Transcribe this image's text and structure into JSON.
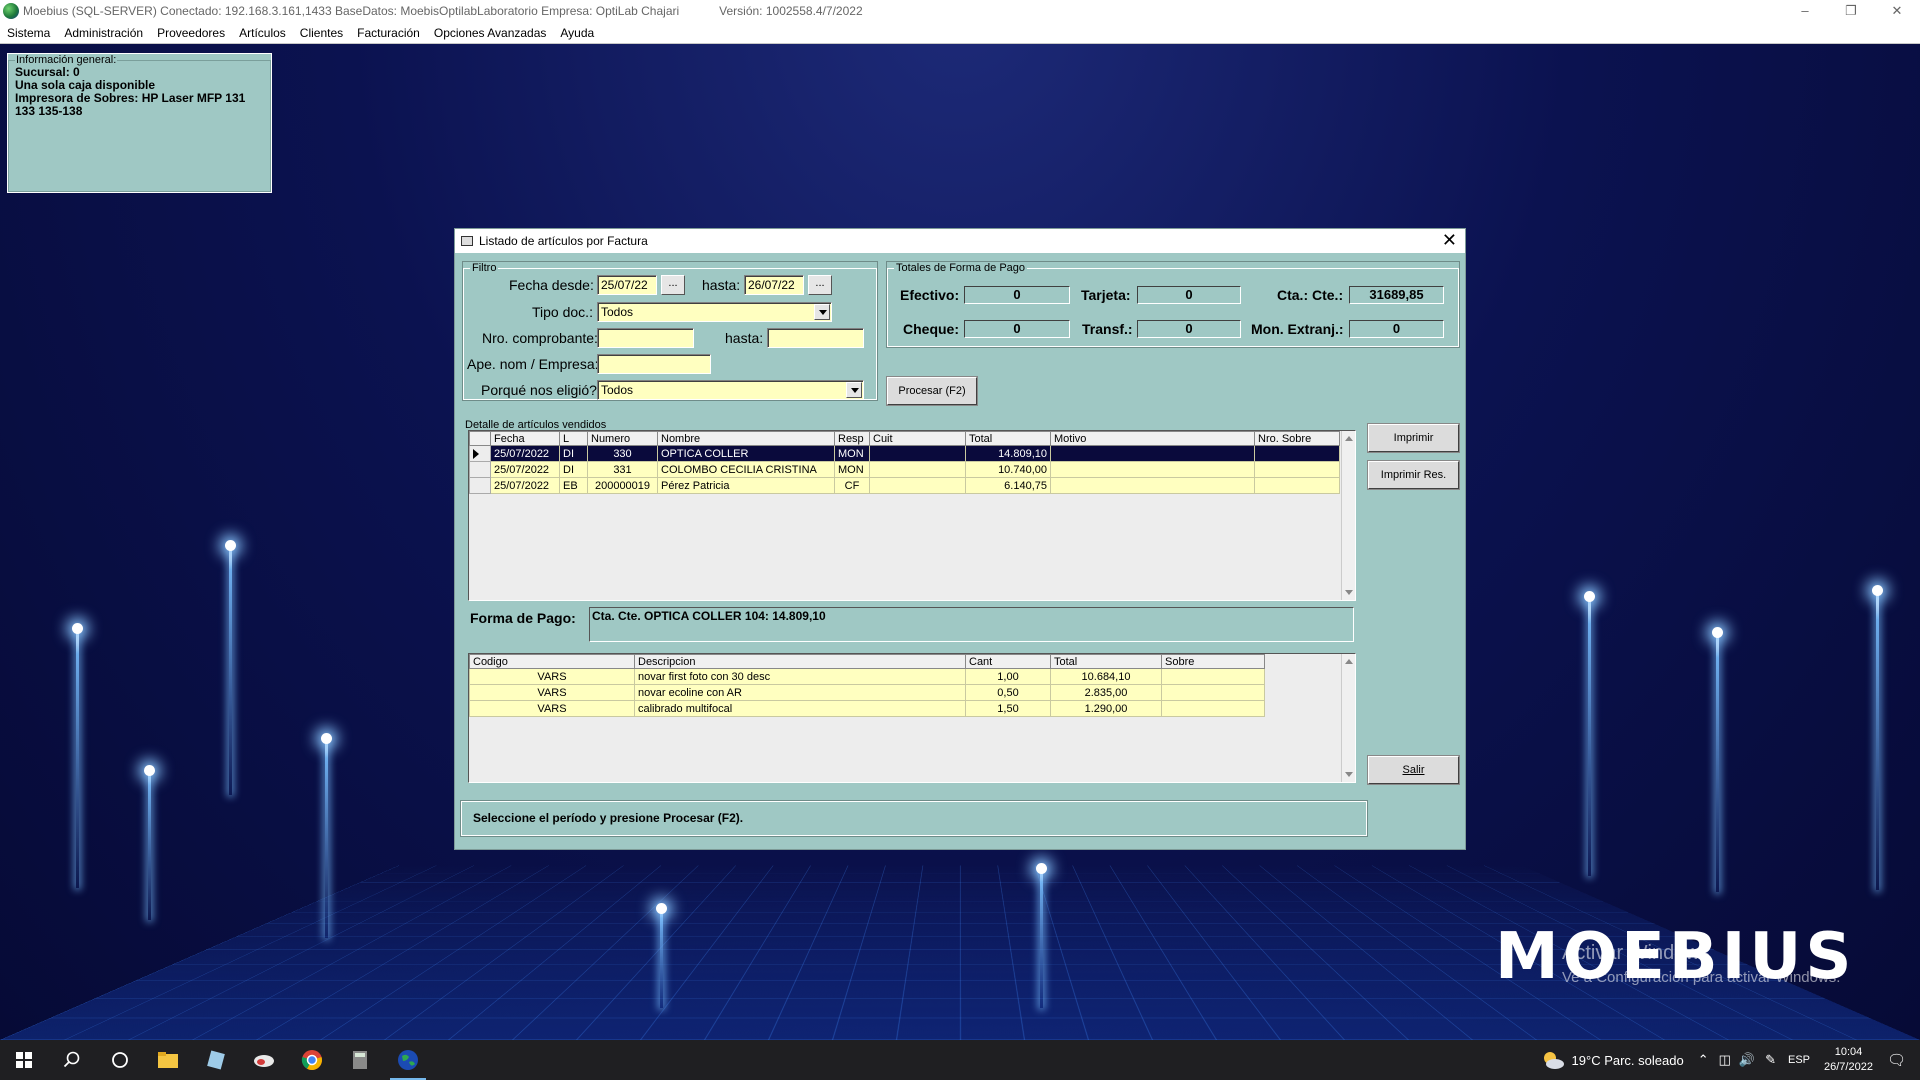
{
  "app": {
    "title": "Moebius (SQL-SERVER) Conectado: 192.168.3.161,1433 BaseDatos: MoebisOptilabLaboratorio Empresa: OptiLab Chajari",
    "version": "Versión: 1002558.4/7/2022",
    "menu": [
      "Sistema",
      "Administración",
      "Proveedores",
      "Artículos",
      "Clientes",
      "Facturación",
      "Opciones Avanzadas",
      "Ayuda"
    ]
  },
  "info_panel": {
    "legend": "Información general:",
    "lines": [
      "Sucursal: 0",
      "Una sola caja disponible",
      "Impresora de Sobres: HP Laser MFP 131",
      "133 135-138"
    ]
  },
  "dialog": {
    "title": "Listado de artículos por Factura",
    "filter": {
      "legend": "Filtro",
      "fecha_desde_label": "Fecha desde:",
      "fecha_desde_value": "25/07/22",
      "hasta_label": "hasta:",
      "hasta_value": "26/07/22",
      "dots": "...",
      "tipo_doc_label": "Tipo doc.:",
      "tipo_doc_value": "Todos",
      "nro_comprobante_label": "Nro. comprobante:",
      "nro_comprobante_value": "",
      "nro_hasta_label": "hasta:",
      "nro_hasta_value": "",
      "ape_nom_label": "Ape. nom / Empresa:",
      "ape_nom_value": "",
      "porque_label": "Porqué nos eligió?",
      "porque_value": "Todos"
    },
    "totals": {
      "legend": "Totales de Forma de Pago",
      "efectivo_label": "Efectivo:",
      "efectivo": "0",
      "tarjeta_label": "Tarjeta:",
      "tarjeta": "0",
      "cta_cte_label": "Cta.: Cte.:",
      "cta_cte": "31689,85",
      "cheque_label": "Cheque:",
      "cheque": "0",
      "transf_label": "Transf.:",
      "transf": "0",
      "mon_extranj_label": "Mon. Extranj.:",
      "mon_extranj": "0"
    },
    "buttons": {
      "procesar": "Procesar (F2)",
      "imprimir": "Imprimir",
      "imprimir_res": "Imprimir Res.",
      "salir": "Salir"
    },
    "detalle": {
      "legend": "Detalle de artículos vendidos",
      "columns": [
        "Fecha",
        "L",
        "Numero",
        "Nombre",
        "Resp",
        "Cuit",
        "Total",
        "Motivo",
        "Nro. Sobre"
      ],
      "rows": [
        {
          "fecha": "25/07/2022",
          "l": "DI",
          "numero": "330",
          "nombre": "OPTICA COLLER",
          "resp": "MON",
          "cuit": "",
          "total": "14.809,10",
          "motivo": "",
          "sobre": "",
          "selected": true
        },
        {
          "fecha": "25/07/2022",
          "l": "DI",
          "numero": "331",
          "nombre": "COLOMBO CECILIA CRISTINA",
          "resp": "MON",
          "cuit": "",
          "total": "10.740,00",
          "motivo": "",
          "sobre": "",
          "selected": false
        },
        {
          "fecha": "25/07/2022",
          "l": "EB",
          "numero": "200000019",
          "nombre": "Pérez Patricia",
          "resp": "CF",
          "cuit": "",
          "total": "6.140,75",
          "motivo": "",
          "sobre": "",
          "selected": false
        }
      ]
    },
    "forma_pago": {
      "label": "Forma de Pago:",
      "value": "Cta. Cte. OPTICA COLLER 104: 14.809,10"
    },
    "items": {
      "columns": [
        "Codigo",
        "Descripcion",
        "Cant",
        "Total",
        "Sobre"
      ],
      "rows": [
        {
          "codigo": "VARS",
          "descripcion": "novar first foto con 30 desc",
          "cant": "1,00",
          "total": "10.684,10",
          "sobre": ""
        },
        {
          "codigo": "VARS",
          "descripcion": "novar ecoline con AR",
          "cant": "0,50",
          "total": "2.835,00",
          "sobre": ""
        },
        {
          "codigo": "VARS",
          "descripcion": "calibrado multifocal",
          "cant": "1,50",
          "total": "1.290,00",
          "sobre": ""
        }
      ]
    },
    "status": "Seleccione el período y presione Procesar (F2)."
  },
  "desktop": {
    "logo": "MOEBIUS",
    "activate_line1": "Activar Windows",
    "activate_line2": "Ve a Configuración para activar Windows."
  },
  "taskbar": {
    "weather": "19°C  Parc. soleado",
    "language": "ESP",
    "time": "10:04",
    "date": "26/7/2022"
  }
}
